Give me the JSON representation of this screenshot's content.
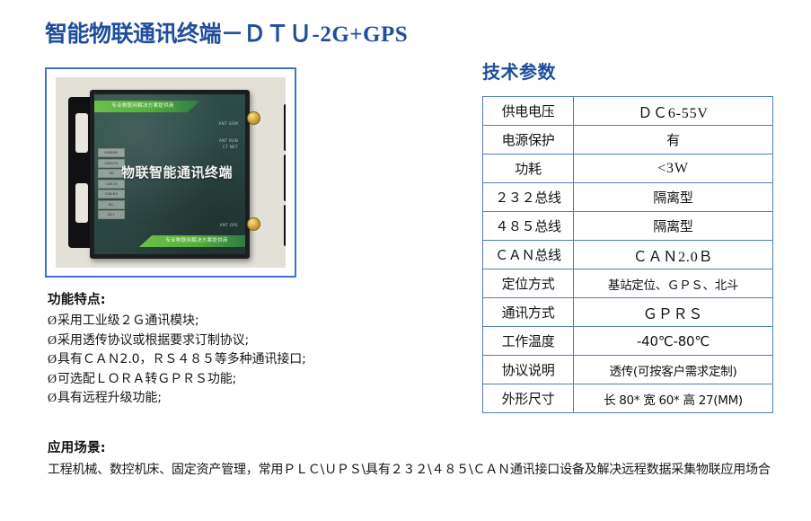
{
  "title": {
    "cn": "智能物联通讯终端",
    "separator": "－",
    "model": "ＤＴＵ-2G+GPS",
    "color": "#1f4e9c"
  },
  "product_photo": {
    "device_label": "物联智能通讯终端",
    "banner_top": "专业物联网解决方案提供商",
    "banner_bottom": "专业物联网解决方案提供商",
    "antenna_top_label": "ANT GSM",
    "antenna_status_label": "ANT  RUN\nCT  NET",
    "antenna_bottom_label": "ANT GPS",
    "terminals": [
      "485B/RX",
      "485A/TX",
      "RD",
      "CAN-TX",
      "CAN-RX",
      "DC-",
      "DC+"
    ],
    "frame_color": "#4472c4"
  },
  "features": {
    "heading": "功能特点:",
    "bullet": "Ø",
    "items": [
      "采用工业级２Ｇ通讯模块;",
      "采用透传协议或根据要求订制协议;",
      "具有ＣＡＮ2.0，ＲＳ４８５等多种通讯接口;",
      "可选配ＬＯＲＡ转ＧＰＲＳ功能;",
      "具有远程升级功能;"
    ]
  },
  "application": {
    "heading": "应用场景:",
    "body": "工程机械、数控机床、固定资产管理，常用ＰＬＣ\\ＵＰＳ\\具有２３２\\４８５\\ＣＡＮ通讯接口设备及解决远程数据采集物联应用场合"
  },
  "spec": {
    "title": "技术参数",
    "border_color": "#4f7ec4",
    "rows": [
      {
        "key": "供电电压",
        "value": "ＤＣ6-55V",
        "style": "serif"
      },
      {
        "key": "电源保护",
        "value": "有",
        "style": "normal"
      },
      {
        "key": "功耗",
        "value": "<3W",
        "style": "serif"
      },
      {
        "key": "２３２总线",
        "value": "隔离型",
        "style": "normal"
      },
      {
        "key": "４８５总线",
        "value": "隔离型",
        "style": "normal"
      },
      {
        "key": "ＣＡＮ总线",
        "value": "ＣＡＮ2.0Ｂ",
        "style": "serif"
      },
      {
        "key": "定位方式",
        "value": "基站定位、ＧＰＳ、北斗",
        "style": "small"
      },
      {
        "key": "通讯方式",
        "value": "ＧＰＲＳ",
        "style": "serif"
      },
      {
        "key": "工作温度",
        "value": "-40℃-80℃",
        "style": "normal"
      },
      {
        "key": "协议说明",
        "value": "透传(可按客户需求定制)",
        "style": "small"
      },
      {
        "key": "外形尺寸",
        "value": "长 80* 宽 60* 高 27(MM)",
        "style": "small"
      }
    ]
  }
}
